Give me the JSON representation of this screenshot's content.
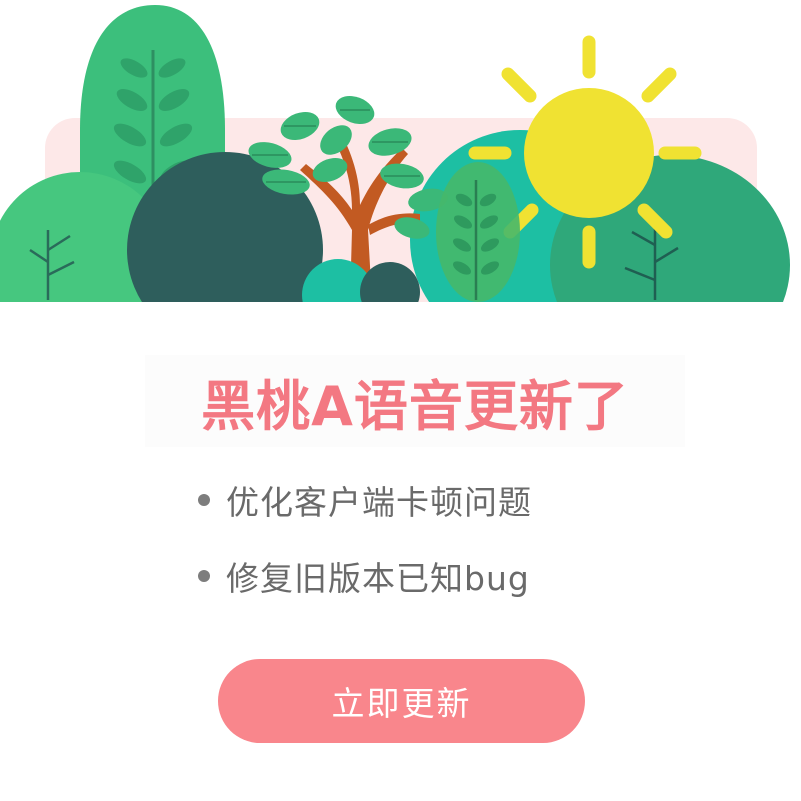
{
  "dialog": {
    "title": "黑桃A语音更新了",
    "notes": [
      "优化客户端卡顿问题",
      "修复旧版本已知bug"
    ],
    "update_button": "立即更新"
  },
  "banner": {
    "icons": [
      "bush",
      "tree",
      "leaf-tree",
      "sun"
    ]
  },
  "colors": {
    "accent": "#f9868c",
    "title": "#f37882",
    "note_text": "#6a6a6a",
    "sun": "#f0e232",
    "banner_bg": "#fde8e8",
    "green_light": "#46c77f",
    "green_teal": "#1dbfa3",
    "green_dark": "#2e5e5c",
    "trunk": "#c25a22"
  }
}
